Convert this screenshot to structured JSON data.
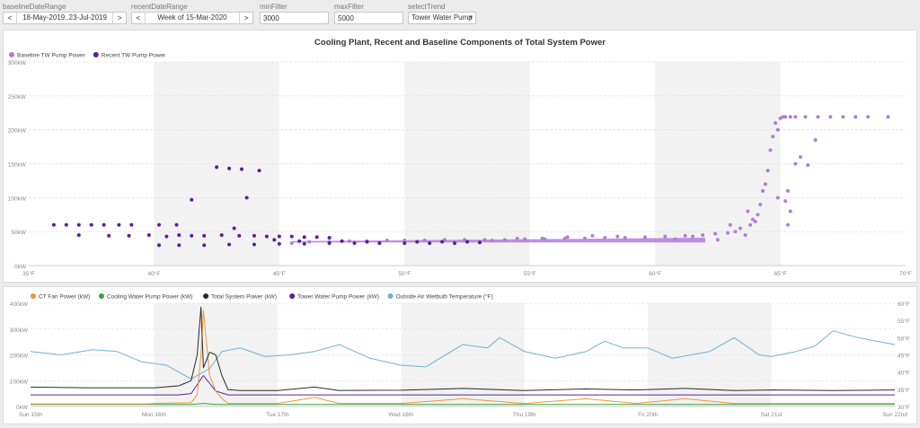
{
  "controls": {
    "baseline": {
      "label": "baselineDateRange",
      "value": "18-May-2019..23-Jul-2019",
      "prev": "<",
      "next": ">"
    },
    "recent": {
      "label": "recentDateRange",
      "value": "Week of 15-Mar-2020",
      "prev": "<",
      "next": ">"
    },
    "min_filter": {
      "label": "minFilter",
      "value": "3000"
    },
    "max_filter": {
      "label": "maxFilter",
      "value": "5000"
    },
    "select_trend": {
      "label": "selectTrend",
      "value": "Tower Water Pump",
      "caret": "▾"
    }
  },
  "colors": {
    "baseline": "#b07fd8",
    "recent": "#5e1d9c",
    "ct_fan": "#f0953a",
    "cooling_water": "#3f9e3a",
    "total_system": "#2b2b2b",
    "tower_water": "#5e1d9c",
    "wetbulb": "#6fb3cf",
    "band": "#f2f2f2",
    "grid": "#e2e2e2"
  },
  "chart_data": [
    {
      "type": "scatter",
      "title": "Cooling Plant, Recent and Baseline Components of Total System Power",
      "xlabel": "",
      "ylabel": "",
      "xlim": [
        35,
        70
      ],
      "ylim": [
        0,
        300
      ],
      "x_ticks": [
        "35°F",
        "40°F",
        "45°F",
        "50°F",
        "55°F",
        "60°F",
        "65°F",
        "70°F"
      ],
      "y_ticks": [
        "0kW",
        "50kW",
        "100kW",
        "150kW",
        "200kW",
        "250kW",
        "300kW"
      ],
      "grid": true,
      "legend_position": "top-left",
      "series": [
        {
          "name": "Baseline TW Pump Power",
          "points": [
            [
              45.5,
              33
            ],
            [
              46.2,
              35
            ],
            [
              47.0,
              35
            ],
            [
              47.8,
              36
            ],
            [
              48.5,
              36
            ],
            [
              49.3,
              37
            ],
            [
              50.0,
              37
            ],
            [
              50.8,
              37
            ],
            [
              51.6,
              38
            ],
            [
              52.4,
              38
            ],
            [
              53.2,
              38
            ],
            [
              54.0,
              38
            ],
            [
              54.8,
              39
            ],
            [
              55.6,
              39
            ],
            [
              56.4,
              40
            ],
            [
              57.2,
              40
            ],
            [
              58.0,
              41
            ],
            [
              58.8,
              41
            ],
            [
              59.6,
              42
            ],
            [
              60.4,
              43
            ],
            [
              61.2,
              44
            ],
            [
              61.9,
              45
            ],
            [
              62.4,
              47
            ],
            [
              62.9,
              48
            ],
            [
              63.2,
              50
            ],
            [
              63.4,
              55
            ],
            [
              63.6,
              45
            ],
            [
              63.8,
              60
            ],
            [
              63.9,
              68
            ],
            [
              64.1,
              75
            ],
            [
              64.2,
              90
            ],
            [
              64.3,
              110
            ],
            [
              64.4,
              120
            ],
            [
              64.5,
              140
            ],
            [
              64.6,
              170
            ],
            [
              64.7,
              190
            ],
            [
              64.8,
              210
            ],
            [
              64.9,
              200
            ],
            [
              65.0,
              217
            ],
            [
              65.1,
              219
            ],
            [
              65.2,
              219
            ],
            [
              65.4,
              219
            ],
            [
              65.6,
              219
            ],
            [
              66.0,
              219
            ],
            [
              66.5,
              219
            ],
            [
              67.0,
              219
            ],
            [
              67.5,
              219
            ],
            [
              68.0,
              219
            ],
            [
              68.5,
              219
            ],
            [
              69.3,
              219
            ],
            [
              65.2,
              95
            ],
            [
              65.3,
              110
            ],
            [
              65.6,
              150
            ],
            [
              65.8,
              160
            ],
            [
              66.1,
              148
            ],
            [
              66.4,
              185
            ],
            [
              64.0,
              65
            ],
            [
              63.0,
              60
            ],
            [
              62.5,
              38
            ],
            [
              61.5,
              43
            ],
            [
              60.8,
              39
            ],
            [
              58.5,
              43
            ],
            [
              57.5,
              44
            ],
            [
              56.5,
              42
            ],
            [
              55.5,
              40
            ],
            [
              54.5,
              40
            ],
            [
              53.5,
              37
            ],
            [
              63.7,
              80
            ],
            [
              64.9,
              100
            ],
            [
              65.4,
              80
            ],
            [
              65.3,
              60
            ]
          ]
        },
        {
          "name": "Recent TW Pump Power",
          "points": [
            [
              36.0,
              60
            ],
            [
              36.5,
              60
            ],
            [
              37.0,
              60
            ],
            [
              37.5,
              60
            ],
            [
              38.0,
              60
            ],
            [
              38.6,
              60
            ],
            [
              39.1,
              60
            ],
            [
              40.2,
              60
            ],
            [
              40.9,
              60
            ],
            [
              37.0,
              45
            ],
            [
              38.2,
              44
            ],
            [
              39.0,
              44
            ],
            [
              39.8,
              45
            ],
            [
              40.5,
              43
            ],
            [
              41.0,
              45
            ],
            [
              41.5,
              44
            ],
            [
              42.0,
              44
            ],
            [
              42.7,
              45
            ],
            [
              43.4,
              44
            ],
            [
              44.0,
              44
            ],
            [
              44.5,
              43
            ],
            [
              45.0,
              43
            ],
            [
              45.5,
              43
            ],
            [
              46.0,
              42
            ],
            [
              46.5,
              42
            ],
            [
              47.0,
              41
            ],
            [
              40.2,
              30
            ],
            [
              41.0,
              30
            ],
            [
              42.0,
              30
            ],
            [
              43.0,
              31
            ],
            [
              44.0,
              31
            ],
            [
              45.0,
              32
            ],
            [
              46.0,
              32
            ],
            [
              47.0,
              33
            ],
            [
              48.0,
              33
            ],
            [
              49.0,
              33
            ],
            [
              50.0,
              33
            ],
            [
              51.0,
              33
            ],
            [
              52.0,
              33
            ],
            [
              53.0,
              34
            ],
            [
              41.5,
              97
            ],
            [
              42.5,
              145
            ],
            [
              43.0,
              143
            ],
            [
              43.5,
              142
            ],
            [
              44.2,
              140
            ],
            [
              43.7,
              100
            ],
            [
              43.2,
              55
            ],
            [
              44.8,
              38
            ],
            [
              45.8,
              36
            ],
            [
              47.5,
              36
            ],
            [
              48.5,
              35
            ],
            [
              50.5,
              35
            ],
            [
              51.5,
              35
            ],
            [
              52.5,
              35
            ]
          ]
        }
      ]
    },
    {
      "type": "line",
      "title": "",
      "xlabel": "",
      "ylabel": "",
      "x_ticks": [
        "Sun 15th",
        "Mon 16th",
        "Tue 17th",
        "Wed 18th",
        "Thu 19th",
        "Fri 20th",
        "Sat 21st",
        "Sun 22nd"
      ],
      "y_left_ticks": [
        "0kW",
        "100kW",
        "200kW",
        "300kW",
        "400kW"
      ],
      "y_left_lim": [
        0,
        400
      ],
      "y_right_ticks": [
        "30°F",
        "35°F",
        "40°F",
        "45°F",
        "50°F",
        "55°F",
        "60°F"
      ],
      "y_right_lim": [
        30,
        60
      ],
      "grid": true,
      "legend_position": "top-left",
      "series": [
        {
          "name": "CT Fan Power (kW)",
          "axis": "left",
          "x": [
            0,
            0.95,
            1.0,
            1.3,
            1.35,
            1.38,
            1.4,
            1.45,
            1.5,
            1.55,
            1.6,
            2.0,
            2.3,
            2.5,
            3.0,
            3.5,
            4.0,
            4.5,
            4.9,
            5.3,
            5.7,
            6.0,
            6.5,
            7.0
          ],
          "y": [
            10,
            10,
            12,
            15,
            45,
            200,
            372,
            120,
            60,
            30,
            12,
            12,
            35,
            12,
            12,
            30,
            12,
            30,
            12,
            30,
            12,
            12,
            12,
            12
          ]
        },
        {
          "name": "Cooling Water Pump Power (kW)",
          "axis": "left",
          "x": [
            0,
            1.3,
            1.4,
            1.5,
            2.0,
            3.0,
            4.0,
            5.0,
            6.0,
            7.0
          ],
          "y": [
            8,
            8,
            12,
            8,
            8,
            8,
            8,
            8,
            8,
            8
          ]
        },
        {
          "name": "Total System Power (kW)",
          "axis": "left",
          "x": [
            0,
            0.5,
            1.0,
            1.2,
            1.3,
            1.35,
            1.38,
            1.4,
            1.45,
            1.5,
            1.55,
            1.6,
            1.7,
            2.0,
            2.3,
            2.5,
            3.0,
            3.5,
            4.0,
            4.5,
            4.9,
            5.3,
            5.7,
            6.0,
            6.5,
            7.0
          ],
          "y": [
            75,
            72,
            72,
            80,
            100,
            200,
            385,
            150,
            210,
            200,
            120,
            65,
            62,
            62,
            75,
            62,
            63,
            70,
            62,
            68,
            64,
            70,
            62,
            64,
            62,
            64
          ]
        },
        {
          "name": "Tower Water Pump Power (kW)",
          "axis": "left",
          "x": [
            0,
            1.0,
            1.2,
            1.3,
            1.4,
            1.5,
            1.6,
            2.0,
            3.0,
            4.0,
            5.0,
            6.0,
            7.0
          ],
          "y": [
            45,
            45,
            45,
            50,
            120,
            60,
            45,
            45,
            45,
            45,
            45,
            45,
            45
          ]
        },
        {
          "name": "Outside Air Wetbulb Temperature (°F)",
          "axis": "right",
          "x": [
            0,
            0.25,
            0.5,
            0.7,
            0.9,
            1.1,
            1.2,
            1.3,
            1.45,
            1.55,
            1.7,
            1.9,
            2.1,
            2.3,
            2.5,
            2.75,
            3.0,
            3.2,
            3.5,
            3.7,
            3.8,
            4.0,
            4.25,
            4.5,
            4.65,
            4.8,
            5.0,
            5.2,
            5.35,
            5.5,
            5.7,
            5.9,
            6.0,
            6.2,
            6.35,
            6.5,
            6.7,
            6.85,
            7.0
          ],
          "y": [
            46,
            45,
            46.5,
            46,
            43,
            42,
            40,
            38,
            41,
            46,
            47,
            44.5,
            45,
            46,
            48,
            44,
            42,
            41.5,
            48,
            47,
            50,
            46,
            44,
            46,
            49,
            47,
            47,
            44,
            45,
            46,
            50,
            45,
            44.5,
            46,
            47.5,
            52,
            50,
            49,
            48
          ]
        }
      ]
    }
  ]
}
